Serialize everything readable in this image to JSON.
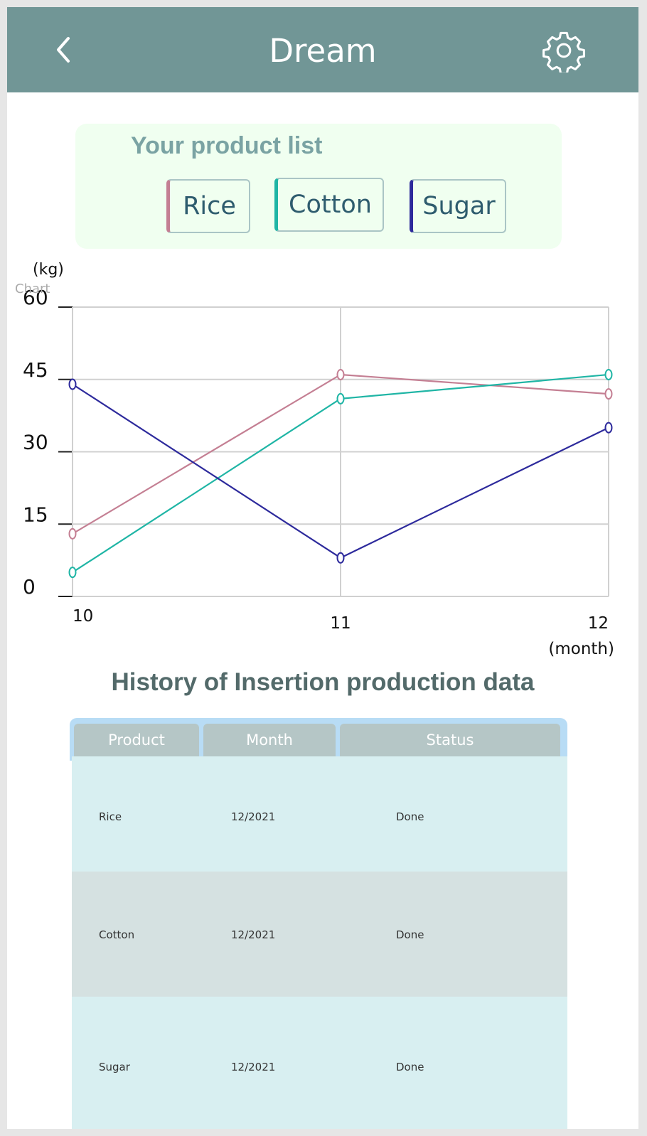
{
  "appbar": {
    "title": "Dream",
    "back_icon": "chevron-left-icon",
    "settings_icon": "gear-icon",
    "color": "#719696"
  },
  "product_card": {
    "heading": "Your product list",
    "chips": [
      {
        "label": "Rice",
        "color": "#c47f93"
      },
      {
        "label": "Cotton",
        "color": "#1fb5a5"
      },
      {
        "label": "Sugar",
        "color": "#2d2a9c"
      }
    ]
  },
  "chart_label": "Chart",
  "chart_data": {
    "type": "line",
    "x": [
      10,
      11,
      12
    ],
    "x_tick_labels": [
      "10",
      "11",
      "12"
    ],
    "ylabel": "(kg)",
    "xlabel": "(month)",
    "y_ticks": [
      0,
      15,
      30,
      45,
      60
    ],
    "ylim": [
      0,
      60
    ],
    "grid": true,
    "series": [
      {
        "name": "Rice",
        "color": "#c47f93",
        "values": [
          13,
          46,
          42
        ]
      },
      {
        "name": "Cotton",
        "color": "#1fb5a5",
        "values": [
          5,
          41,
          46
        ]
      },
      {
        "name": "Sugar",
        "color": "#2d2a9c",
        "values": [
          44,
          8,
          35
        ]
      }
    ]
  },
  "history": {
    "title": "History of  Insertion production data",
    "columns": [
      "Product",
      "Month",
      "Status"
    ],
    "rows": [
      {
        "product": "Rice",
        "month": "12/2021",
        "status": "Done"
      },
      {
        "product": "Cotton",
        "month": "12/2021",
        "status": "Done"
      },
      {
        "product": "Sugar",
        "month": "12/2021",
        "status": "Done"
      }
    ]
  }
}
